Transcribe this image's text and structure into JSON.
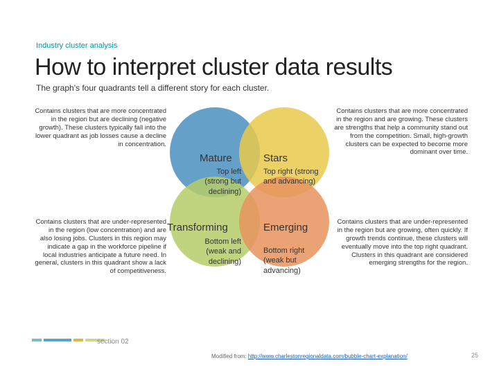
{
  "eyebrow": "Industry cluster analysis",
  "title": "How to interpret cluster data results",
  "subtitle": "The graph's four quadrants tell a different story for each cluster.",
  "quadrants": {
    "tl": {
      "name": "Mature",
      "sub": "Top left (strong but declining)",
      "desc": "Contains clusters that are more concentrated in the region but are declining (negative growth). These clusters typically fall into the lower quadrant as job losses cause a decline in concentration."
    },
    "tr": {
      "name": "Stars",
      "sub": "Top right (strong and advancing)",
      "desc": "Contains clusters that are more concentrated in the region and are growing. These clusters are strengths that help a community stand out from the competition. Small, high-growth clusters can be expected to become more dominant over time."
    },
    "bl": {
      "name": "Transforming",
      "sub": "Bottom left (weak and declining)",
      "desc": "Contains clusters that are under-represented in the region (low concentration) and are also losing jobs. Clusters in this region may indicate a gap in the workforce pipeline if local industries anticipate a future need. In general, clusters in this quadrant show a lack of competitiveness."
    },
    "br": {
      "name": "Emerging",
      "sub": "Bottom right (weak but advancing)",
      "desc": "Contains clusters that are under-represented in the region but are growing, often quickly. If growth trends continue, these clusters will eventually move into the top right quadrant. Clusters in this quadrant are considered emerging strengths for the region."
    }
  },
  "section": "section 02",
  "footer_prefix": "Modified from: ",
  "footer_link": "http://www.charlestonregionaldata.com/bubble-chart-explanation/",
  "page_num": "25",
  "colors": {
    "tl": "#4a8fbf",
    "tr": "#e9c94b",
    "bl": "#b5cc6a",
    "br": "#e8935e"
  }
}
